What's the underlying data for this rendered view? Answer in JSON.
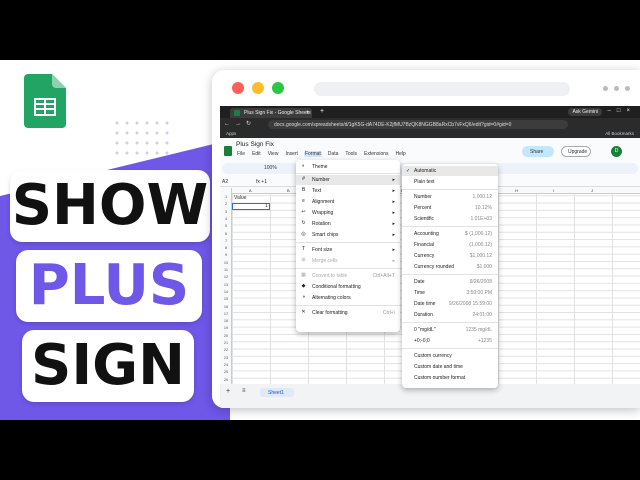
{
  "thumbnail": {
    "words": [
      "SHOW",
      "PLUS",
      "SIGN"
    ],
    "accent_color": "#6f57e8",
    "logo": "google-sheets-logo"
  },
  "browser": {
    "tab_title": "Plus Sign Fix - Google Sheets",
    "new_tab": "+",
    "ask_gemini": "Ask Gemini",
    "url": "docs.google.com/spreadsheets/d/1gK5G-dA74DE-K2jfMU7BzQK8NGGB8aRxCb7vFxQ6/edit?gid=0#gid=0",
    "apps": "Apps",
    "all_bookmarks": "All Bookmarks"
  },
  "sheets": {
    "title": "Plus Sign Fix",
    "menu": [
      "File",
      "Edit",
      "View",
      "Insert",
      "Format",
      "Data",
      "Tools",
      "Extensions",
      "Help"
    ],
    "share": "Share",
    "upgrade": "Upgrade",
    "avatar": "D",
    "zoom": "100%",
    "name_box": "A2",
    "formula": "+1",
    "columns": [
      "A",
      "B",
      "C",
      "D",
      "E",
      "F",
      "G",
      "H",
      "I",
      "J"
    ],
    "rows": [
      "1",
      "2",
      "3",
      "4",
      "5",
      "6",
      "7",
      "8",
      "9",
      "10",
      "11",
      "12",
      "13",
      "14",
      "15",
      "16",
      "17",
      "18",
      "19",
      "20",
      "21",
      "22",
      "23",
      "24",
      "25",
      "26"
    ],
    "cell_a1": "Value",
    "cell_a2": "1",
    "sheet_tab": "Sheet1",
    "add_sheet": "+",
    "all_sheets": "≡"
  },
  "format_menu": {
    "theme": "Theme",
    "number": "Number",
    "text": "Text",
    "alignment": "Alignment",
    "wrapping": "Wrapping",
    "rotation": "Rotation",
    "smart_chips": "Smart chips",
    "font_size": "Font size",
    "merge_cells": "Merge cells",
    "convert_table": "Convert to table",
    "convert_table_sc": "Ctrl+Alt+T",
    "conditional": "Conditional formatting",
    "alternating": "Alternating colors",
    "clear": "Clear formatting",
    "clear_sc": "Ctrl+\\"
  },
  "number_menu": {
    "items": [
      {
        "label": "Automatic",
        "example": ""
      },
      {
        "label": "Plain text",
        "example": ""
      },
      {
        "label": "Number",
        "example": "1,000.12"
      },
      {
        "label": "Percent",
        "example": "10.12%"
      },
      {
        "label": "Scientific",
        "example": "1.01E+03"
      },
      {
        "label": "Accounting",
        "example": "$ (1,000.12)"
      },
      {
        "label": "Financial",
        "example": "(1,000.12)"
      },
      {
        "label": "Currency",
        "example": "$1,000.12"
      },
      {
        "label": "Currency rounded",
        "example": "$1,000"
      },
      {
        "label": "Date",
        "example": "9/26/2008"
      },
      {
        "label": "Time",
        "example": "3:59:00 PM"
      },
      {
        "label": "Date time",
        "example": "9/26/2008 15:59:00"
      },
      {
        "label": "Duration",
        "example": "24:01:00"
      },
      {
        "label": "0 \"mg/dL\"",
        "example": "1235 mg/dL"
      },
      {
        "label": "+0;-0;0",
        "example": "+1235"
      },
      {
        "label": "Custom currency",
        "example": ""
      },
      {
        "label": "Custom date and time",
        "example": ""
      },
      {
        "label": "Custom number format",
        "example": ""
      }
    ]
  }
}
